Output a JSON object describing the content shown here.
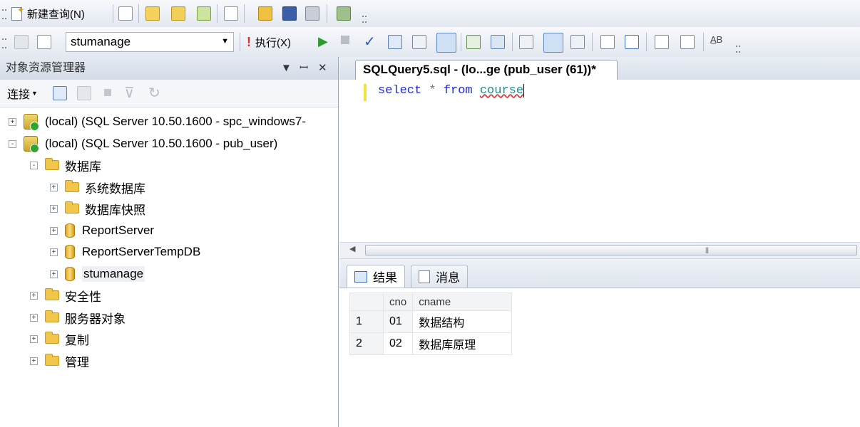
{
  "toolbar1": {
    "new_query_label": "新建查询(N)",
    "icons": [
      "new-query-icon",
      "database-engine-query-icon",
      "analysis-services-mdx-icon",
      "analysis-services-dmx-icon",
      "analysis-services-xmla-icon",
      "new-file-icon",
      "open-file-icon",
      "save-icon",
      "print-icon",
      "activity-monitor-icon"
    ]
  },
  "toolbar2": {
    "database_selector": "stumanage",
    "execute_label": "执行(X)",
    "icons": [
      "connect-icon",
      "change-connection-icon",
      "debug-icon",
      "stop-icon",
      "parse-icon",
      "display-estimated-plan-icon",
      "query-designer-icon",
      "results-to-grid-icon",
      "include-actual-plan-icon",
      "include-client-statistics-icon",
      "results-to-text-icon",
      "results-to-file-icon",
      "comment-icon",
      "uncomment-icon",
      "decrease-indent-icon",
      "increase-indent-icon",
      "specify-template-values-icon"
    ]
  },
  "object_explorer": {
    "title": "对象资源管理器",
    "connect_label": "连接",
    "tree": [
      {
        "label": "(local) (SQL Server 10.50.1600 - spc_windows7-",
        "expander": "+"
      },
      {
        "label": "(local) (SQL Server 10.50.1600 - pub_user)",
        "expander": "-"
      },
      {
        "label": "数据库",
        "expander": "-"
      },
      {
        "label": "系统数据库",
        "expander": "+"
      },
      {
        "label": "数据库快照",
        "expander": "+"
      },
      {
        "label": "ReportServer",
        "expander": "+"
      },
      {
        "label": "ReportServerTempDB",
        "expander": "+"
      },
      {
        "label": "stumanage",
        "expander": "+"
      },
      {
        "label": "安全性",
        "expander": "+"
      },
      {
        "label": "服务器对象",
        "expander": "+"
      },
      {
        "label": "复制",
        "expander": "+"
      },
      {
        "label": "管理",
        "expander": "+"
      }
    ]
  },
  "editor": {
    "tab_title": "SQLQuery5.sql - (lo...ge (pub_user (61))*",
    "query": {
      "kw1": "select",
      "star": "*",
      "kw2": "from",
      "table": "course"
    }
  },
  "results": {
    "tab_results": "结果",
    "tab_messages": "消息",
    "columns": [
      "cno",
      "cname"
    ],
    "rows": [
      {
        "num": "1",
        "cno": "01",
        "cname": "数据结构"
      },
      {
        "num": "2",
        "cno": "02",
        "cname": "数据库原理"
      }
    ]
  },
  "colors": {
    "toolbar_bg": "#e3e8f0",
    "keyword": "#1d29d6",
    "table_name": "#1d8f8f",
    "execute_icon": "#d23030"
  }
}
